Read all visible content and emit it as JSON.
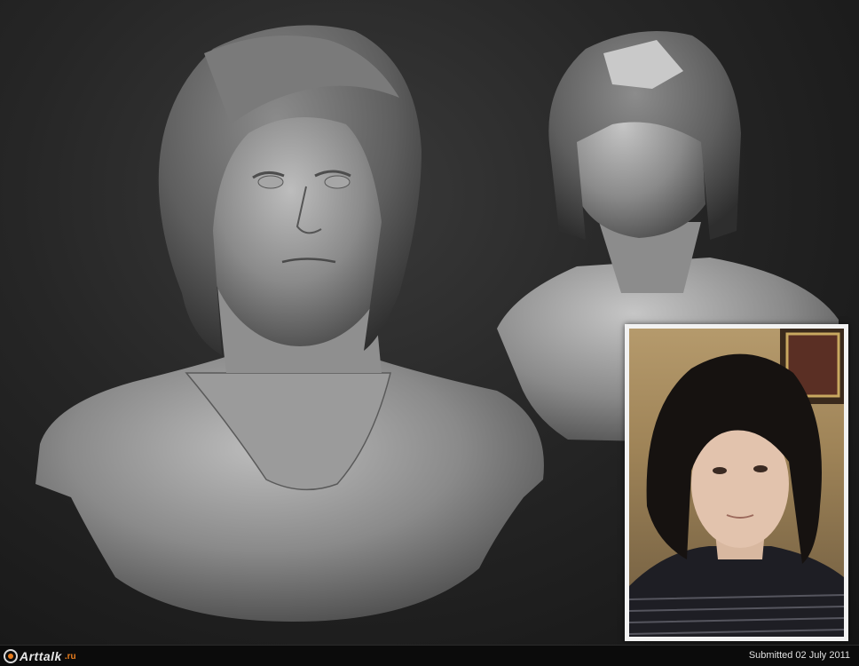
{
  "footer": {
    "logo_text": "Arttalk",
    "logo_tld": ".ru",
    "submitted": "Submitted 02 July 2011"
  },
  "colors": {
    "background": "#262626",
    "sculpt": "#8e8e8e",
    "accent": "#e87d1e"
  }
}
